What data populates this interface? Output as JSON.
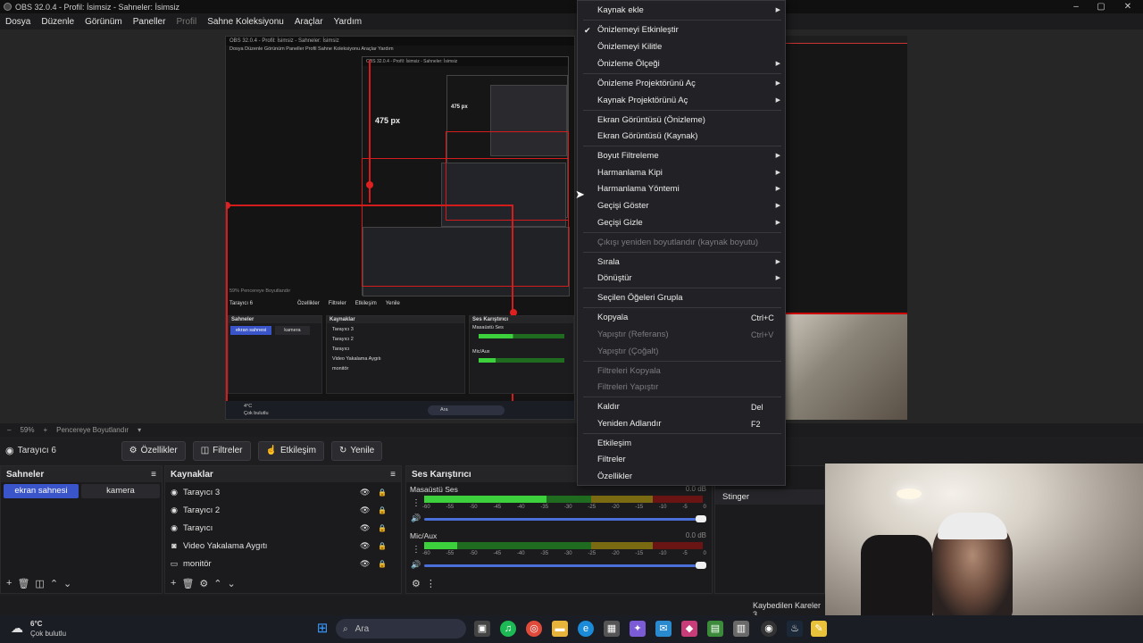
{
  "window": {
    "title": "OBS 32.0.4 - Profil: İsimsiz - Sahneler: İsimsiz",
    "minimize": "–",
    "maximize": "▢",
    "close": "✕"
  },
  "menubar": [
    "Dosya",
    "Düzenle",
    "Görünüm",
    "Paneller",
    "Profil",
    "Sahne Koleksiyonu",
    "Araçlar",
    "Yardım"
  ],
  "preview": {
    "nested_title": "OBS 32.0.4 - Profil: İsimsiz - Sahneler: İsimsiz",
    "nested_menu": "Dosya  Düzenle  Görünüm  Paneller  Profil  Sahne Koleksiyonu  Araçlar  Yardım",
    "label_475_a": "475 px",
    "label_475_b": "475 px",
    "nested_source": "Tarayıcı 6",
    "nested_zoom": "59%",
    "nested_fit": "Pencereye Boyutlandır",
    "nested_buttons": [
      "Özellikler",
      "Filtreler",
      "Etkileşim",
      "Yenile"
    ],
    "nested_scenes_h": "Sahneler",
    "nested_sources_h": "Kaynaklar",
    "nested_mixer_h": "Ses Karıştırıcı",
    "nested_scene1": "ekran sahnesi",
    "nested_scene2": "kamera",
    "nested_sources": [
      "Tarayıcı 3",
      "Tarayıcı 2",
      "Tarayıcı",
      "Video Yakalama Aygıtı",
      "monitör"
    ],
    "nested_mixer1": "Masaüstü Ses",
    "nested_mixer2": "Mic/Aux",
    "nested_weather": "4°C",
    "nested_weather2": "Çok bulutlu",
    "nested_search": "Ara"
  },
  "zoombar": {
    "zoom": "59%",
    "fit": "Pencereye Boyutlandır",
    "minus": "–",
    "plus": "+"
  },
  "source_toolbar": {
    "source_name": "Tarayıcı 6",
    "buttons": [
      "Özellikler",
      "Filtreler",
      "Etkileşim",
      "Yenile"
    ]
  },
  "scenes": {
    "title": "Sahneler",
    "items": [
      "ekran sahnesi",
      "kamera"
    ]
  },
  "sources": {
    "title": "Kaynaklar",
    "items": [
      {
        "label": "Tarayıcı 3",
        "icon": "globe-icon"
      },
      {
        "label": "Tarayıcı 2",
        "icon": "globe-icon"
      },
      {
        "label": "Tarayıcı",
        "icon": "globe-icon"
      },
      {
        "label": "Video Yakalama Aygıtı",
        "icon": "camera-icon"
      },
      {
        "label": "monitör",
        "icon": "monitor-icon"
      }
    ]
  },
  "mixer": {
    "title": "Ses Karıştırıcı",
    "channels": [
      {
        "name": "Masaüstü Ses",
        "db": "0.0 dB",
        "level": 0.44
      },
      {
        "name": "Mic/Aux",
        "db": "0.0 dB",
        "level": 0.12
      }
    ],
    "ticks": [
      "-60",
      "-55",
      "-50",
      "-45",
      "-40",
      "-35",
      "-30",
      "-25",
      "-20",
      "-15",
      "-10",
      "-5",
      "0"
    ]
  },
  "transitions": {
    "item": "Stinger"
  },
  "status": {
    "dropped_frames": "Kaybedilen Kareler 3"
  },
  "taskbar": {
    "temp": "6°C",
    "weather": "Çok bulutlu",
    "search": "Ara"
  },
  "context_menu": {
    "items": [
      {
        "label": "Kaynak ekle",
        "submenu": true
      },
      {
        "label": "Önizlemeyi Etkinleştir",
        "checked": true
      },
      {
        "label": "Önizlemeyi Kilitle"
      },
      {
        "label": "Önizleme Ölçeği",
        "submenu": true
      },
      {
        "label": "Önizleme Projektörünü Aç",
        "submenu": true
      },
      {
        "label": "Kaynak Projektörünü Aç",
        "submenu": true
      },
      {
        "label": "Ekran Görüntüsü (Önizleme)"
      },
      {
        "label": "Ekran Görüntüsü (Kaynak)"
      },
      {
        "label": "Boyut Filtreleme",
        "submenu": true
      },
      {
        "label": "Harmanlama Kipi",
        "submenu": true
      },
      {
        "label": "Harmanlama Yöntemi",
        "submenu": true
      },
      {
        "label": "Geçişi Göster",
        "submenu": true
      },
      {
        "label": "Geçişi Gizle",
        "submenu": true
      },
      {
        "label": "Çıkışı yeniden boyutlandır (kaynak boyutu)",
        "disabled": true
      },
      {
        "label": "Sırala",
        "submenu": true
      },
      {
        "label": "Dönüştür",
        "submenu": true
      },
      {
        "label": "Seçilen Öğeleri Grupla"
      },
      {
        "label": "Kopyala",
        "shortcut": "Ctrl+C"
      },
      {
        "label": "Yapıştır (Referans)",
        "shortcut": "Ctrl+V",
        "disabled": true
      },
      {
        "label": "Yapıştır (Çoğalt)",
        "disabled": true
      },
      {
        "label": "Filtreleri Kopyala",
        "disabled": true
      },
      {
        "label": "Filtreleri Yapıştır",
        "disabled": true
      },
      {
        "label": "Kaldır",
        "shortcut": "Del"
      },
      {
        "label": "Yeniden Adlandır",
        "shortcut": "F2"
      },
      {
        "label": "Etkileşim"
      },
      {
        "label": "Filtreler"
      },
      {
        "label": "Özellikler"
      }
    ]
  },
  "colors": {
    "accent": "#3a55c9",
    "selection_red": "#d41c1c",
    "meter_green": "#3cd13c"
  }
}
